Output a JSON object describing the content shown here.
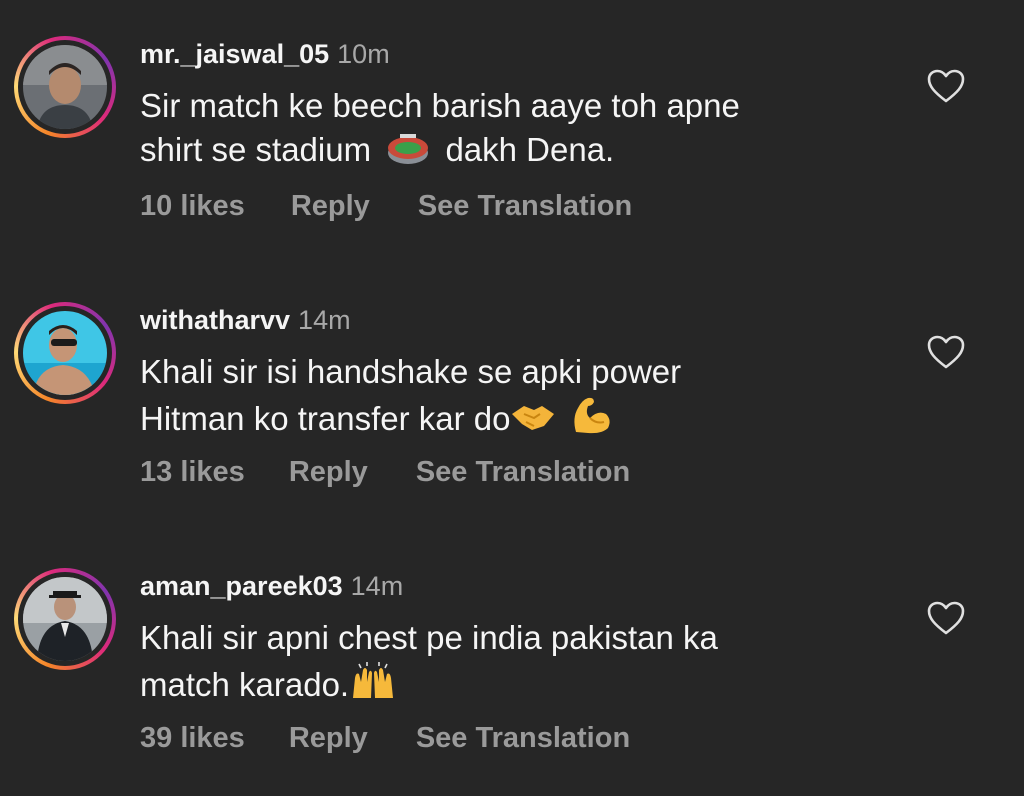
{
  "comments": [
    {
      "username": "mr._jaiswal_05",
      "time": "10m",
      "line1": "Sir match ke beech barish aaye toh apne",
      "line2a": "shirt se stadium",
      "line2_emoji": "stadium-emoji",
      "line2b": "dakh Dena.",
      "likes": "10 likes",
      "reply": "Reply",
      "translate": "See Translation",
      "heart_icon": "heart-outline-icon"
    },
    {
      "username": "withatharvv",
      "time": "14m",
      "line1": "Khali sir isi handshake se apki power",
      "line2a": "Hitman ko transfer kar do",
      "line2_emoji": "handshake-emoji, flexed-biceps-emoji",
      "line2b": "",
      "likes": "13 likes",
      "reply": "Reply",
      "translate": "See Translation",
      "heart_icon": "heart-outline-icon"
    },
    {
      "username": "aman_pareek03",
      "time": "14m",
      "line1": "Khali sir apni chest pe india pakistan ka",
      "line2a": "match karado.",
      "line2_emoji": "raising-hands-emoji",
      "line2b": "",
      "likes": "39 likes",
      "reply": "Reply",
      "translate": "See Translation",
      "heart_icon": "heart-outline-icon"
    }
  ],
  "colors": {
    "background": "#262626",
    "text_primary": "#f5f5f5",
    "text_secondary": "#9a9a9a",
    "ring_gradient": [
      "#f58529",
      "#feda77",
      "#dd2a7b",
      "#8134af"
    ]
  }
}
